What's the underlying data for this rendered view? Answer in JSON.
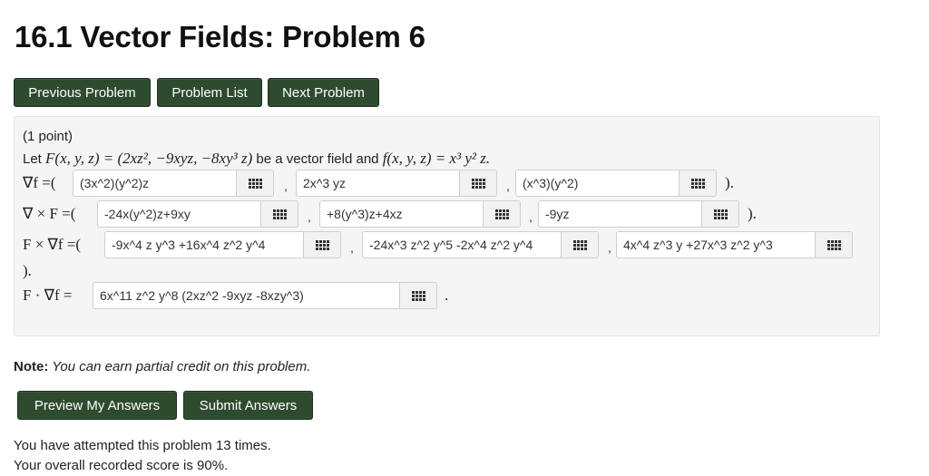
{
  "page": {
    "title": "16.1 Vector Fields: Problem 6"
  },
  "nav": {
    "previous": "Previous Problem",
    "list": "Problem List",
    "next": "Next Problem"
  },
  "problem": {
    "points": "(1 point)",
    "statement": {
      "let": "Let ",
      "F_def": "F(x, y, z) = (2xz², −9xyz, −8xy³ z)",
      "middle": " be a vector field and ",
      "f_def": "f(x, y, z) = x³ y² z."
    },
    "grad": {
      "label": "∇f =(",
      "close": ").",
      "answers": [
        "(3x^2)(y^2)z",
        "2x^3 yz",
        "(x^3)(y^2)"
      ]
    },
    "curl": {
      "label": "∇ × F =(",
      "close": ").",
      "answers": [
        "-24x(y^2)z+9xy",
        "+8(y^3)z+4xz",
        "-9yz"
      ]
    },
    "cross": {
      "label": "F × ∇f =(",
      "close": ").",
      "answers": [
        "-9x^4 z y^3 +16x^4 z^2 y^4",
        "-24x^3 z^2 y^5 -2x^4 z^2 y^4",
        "4x^4 z^3 y +27x^3 z^2 y^3"
      ]
    },
    "dot": {
      "label": "F · ∇f =",
      "close": ".",
      "answer": "6x^11 z^2 y^8 (2xz^2 -9xyz -8xzy^3)"
    },
    "comma": ","
  },
  "note": {
    "label": "Note:",
    "text": " You can earn partial credit on this problem."
  },
  "actions": {
    "preview": "Preview My Answers",
    "submit": "Submit Answers"
  },
  "status": {
    "attempts": "You have attempted this problem 13 times.",
    "score": "Your overall recorded score is 90%."
  },
  "icons": {
    "palette": "equation-palette-icon"
  },
  "colors": {
    "button": "#2e4a2f",
    "panel": "#f5f5f5"
  }
}
